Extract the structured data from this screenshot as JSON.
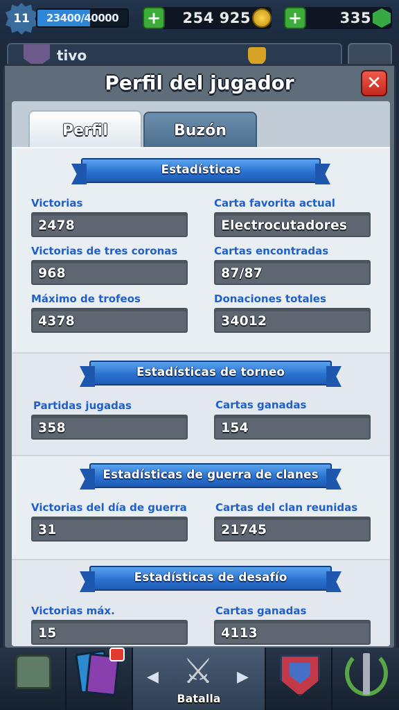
{
  "hud": {
    "level": "11",
    "xp_text": "23400/40000",
    "xp_progress": 0.585,
    "gold": "254 925",
    "gems": "335",
    "plus_symbol": "+",
    "player_name_behind": "tivo"
  },
  "modal": {
    "title": "Perfil del jugador",
    "close_symbol": "✕",
    "tabs": [
      {
        "label": "Perfil",
        "active": true
      },
      {
        "label": "Buzón",
        "active": false
      }
    ]
  },
  "sections": {
    "stats": {
      "title": "Estadísticas",
      "items": [
        {
          "label": "Victorias",
          "value": "2478"
        },
        {
          "label": "Carta favorita actual",
          "value": "Electrocutadores"
        },
        {
          "label": "Victorias de tres coronas",
          "value": "968"
        },
        {
          "label": "Cartas encontradas",
          "value": "87/87"
        },
        {
          "label": "Máximo de trofeos",
          "value": "4378"
        },
        {
          "label": "Donaciones totales",
          "value": "34012"
        }
      ]
    },
    "tournament": {
      "title": "Estadísticas de torneo",
      "items": [
        {
          "label": "Partidas jugadas",
          "value": "358"
        },
        {
          "label": "Cartas ganadas",
          "value": "154"
        }
      ]
    },
    "clan_war": {
      "title": "Estadísticas de guerra de clanes",
      "items": [
        {
          "label": "Victorias del día de guerra",
          "value": "31"
        },
        {
          "label": "Cartas del clan reunidas",
          "value": "21745"
        }
      ]
    },
    "challenge": {
      "title": "Estadísticas de desafío",
      "items": [
        {
          "label": "Victorias máx.",
          "value": "15"
        },
        {
          "label": "Cartas ganadas",
          "value": "4113"
        }
      ]
    }
  },
  "bottom_nav": {
    "items": [
      {
        "icon": "shop-chest-icon"
      },
      {
        "icon": "cards-icon"
      },
      {
        "icon": "crossed-swords-icon",
        "label": "Batalla",
        "active": true
      },
      {
        "icon": "clan-shield-icon"
      },
      {
        "icon": "tournament-laurel-icon"
      }
    ],
    "arrow_left": "◀",
    "arrow_right": "▶"
  },
  "colors": {
    "label_blue": "#2060c8",
    "ribbon_blue": "#2a72d0",
    "close_red": "#d8382a",
    "plus_green": "#3dac3a"
  }
}
